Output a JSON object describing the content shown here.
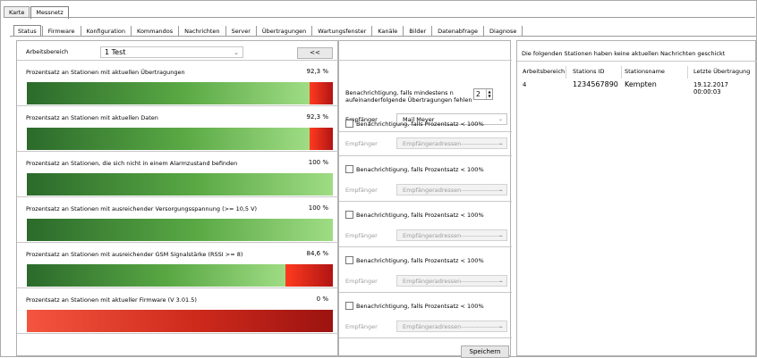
{
  "top_tabs": [
    {
      "label": "Karte"
    },
    {
      "label": "Messnetz"
    }
  ],
  "tabs": [
    "Status",
    "Firmware",
    "Konfiguration",
    "Kommandos",
    "Nachrichten",
    "Server",
    "Übertragungen",
    "Wartungsfenster",
    "Kanäle",
    "Bilder",
    "Datenabfrage",
    "Diagnose"
  ],
  "active_tab": "Status",
  "area": {
    "label": "Arbeitsbereich",
    "value": "1 Test",
    "collapse_label": "<<"
  },
  "stats": [
    {
      "title": "Prozentsatz an Stationen mit aktuellen Übertragungen",
      "pct_label": "92,3 %",
      "pct": 92.3
    },
    {
      "title": "Prozentsatz an Stationen mit aktuellen Daten",
      "pct_label": "92,3 %",
      "pct": 92.3
    },
    {
      "title": "Prozentsatz an Stationen, die sich nicht in einem Alarmzustand befinden",
      "pct_label": "100 %",
      "pct": 100
    },
    {
      "title": "Prozentsatz an Stationen mit ausreichender Versorgungsspannung (>= 10,5 V)",
      "pct_label": "100 %",
      "pct": 100
    },
    {
      "title": "Prozentsatz an Stationen mit ausreichender GSM Signalstärke (RSSI >= 8)",
      "pct_label": "84,6 %",
      "pct": 84.6
    },
    {
      "title": "Prozentsatz an Stationen mit aktueller Firmware (V 3.01.5)",
      "pct_label": "0 %",
      "pct": 0
    }
  ],
  "notify": {
    "first_line1": "Benachrichtigung, falls mindestens n",
    "first_line2": "aufeinanderfolgende Übertragungen fehlen",
    "n_value": "2",
    "recipient_label": "Empfänger",
    "recipient_value": "Mail Meyer",
    "checkbox_label": "Benachrichtigung, falls Prozentsatz < 100%",
    "placeholder": "Empfängeradressen--------------------",
    "save_label": "Speichern"
  },
  "right": {
    "heading": "Die folgenden Stationen haben keine aktuellen Nachrichten geschickt",
    "columns": [
      "Arbeitsbereich",
      "Stations ID",
      "Stationsname",
      "Letzte Übertragung"
    ],
    "rows": [
      {
        "area": "4",
        "id": "1234567890",
        "name": "Kempten",
        "last": "19.12.2017 00:00:03"
      }
    ]
  },
  "colors": {
    "green_dark": "#2b6a2b",
    "green_light": "#9fdc84",
    "red": "#ff3b1f",
    "red_dark": "#b11414"
  }
}
